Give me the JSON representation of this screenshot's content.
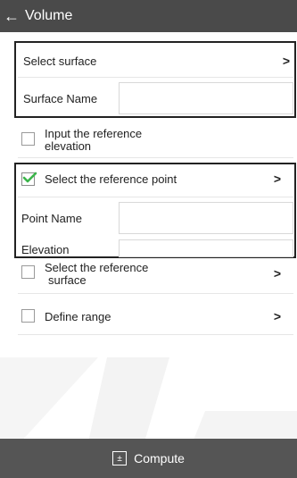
{
  "header": {
    "back_icon": "arrow-left-icon",
    "title": "Volume"
  },
  "group1": {
    "select_surface": {
      "label": "Select surface",
      "chevron": ">"
    },
    "surface_name": {
      "label": "Surface Name",
      "value": ""
    }
  },
  "input_ref_elev": {
    "label_line1": "Input the reference",
    "label_line2": "elevation",
    "checked": false
  },
  "group2": {
    "select_ref_point": {
      "label": "Select the reference point",
      "chevron": ">",
      "checked": true
    },
    "point_name": {
      "label": "Point Name",
      "value": ""
    },
    "elevation": {
      "label": "Elevation",
      "value": ""
    }
  },
  "select_ref_surface": {
    "label_line1": "Select the reference",
    "label_line2": "surface",
    "chevron": ">",
    "checked": false
  },
  "define_range": {
    "label": "Define range",
    "chevron": ">",
    "checked": false
  },
  "bottom": {
    "icon": "calculator-icon",
    "compute_label": "Compute"
  },
  "colors": {
    "appbar": "#4a4a4a",
    "bottombar": "#555555",
    "checkmark": "#3bb54a"
  }
}
